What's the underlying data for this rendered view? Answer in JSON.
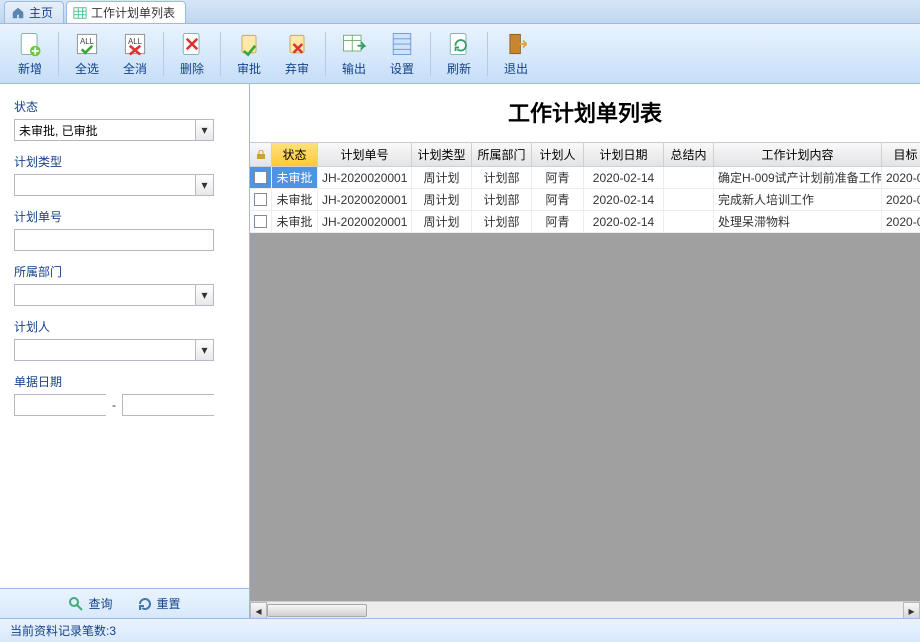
{
  "tabs": [
    {
      "label": "主页",
      "icon": "home"
    },
    {
      "label": "工作计划单列表",
      "icon": "grid",
      "active": true
    }
  ],
  "toolbar": [
    {
      "key": "new",
      "label": "新增"
    },
    {
      "key": "selall",
      "label": "全选"
    },
    {
      "key": "desel",
      "label": "全消"
    },
    {
      "key": "delete",
      "label": "删除"
    },
    {
      "key": "approve",
      "label": "审批"
    },
    {
      "key": "reject",
      "label": "弃审"
    },
    {
      "key": "export",
      "label": "输出"
    },
    {
      "key": "settings",
      "label": "设置"
    },
    {
      "key": "refresh",
      "label": "刷新"
    },
    {
      "key": "exit",
      "label": "退出"
    }
  ],
  "title": "工作计划单列表",
  "filters": {
    "status": {
      "label": "状态",
      "value": "未审批, 已审批"
    },
    "plantype": {
      "label": "计划类型",
      "value": ""
    },
    "planno": {
      "label": "计划单号",
      "value": ""
    },
    "dept": {
      "label": "所属部门",
      "value": ""
    },
    "planner": {
      "label": "计划人",
      "value": ""
    },
    "date": {
      "label": "单据日期",
      "from": "",
      "to": "",
      "sep": "-"
    }
  },
  "sidefoot": {
    "query": "查询",
    "reset": "重置"
  },
  "grid": {
    "headers": [
      "",
      "状态",
      "计划单号",
      "计划类型",
      "所属部门",
      "计划人",
      "计划日期",
      "总结内",
      "工作计划内容",
      "目标"
    ],
    "sorted_col": 1,
    "rows": [
      {
        "selected": true,
        "status": "未审批",
        "no": "JH-2020020001",
        "type": "周计划",
        "dept": "计划部",
        "planner": "阿青",
        "date": "2020-02-14",
        "summary": "",
        "content": "确定H-009试产计划前准备工作",
        "target": "2020-0"
      },
      {
        "selected": false,
        "status": "未审批",
        "no": "JH-2020020001",
        "type": "周计划",
        "dept": "计划部",
        "planner": "阿青",
        "date": "2020-02-14",
        "summary": "",
        "content": "完成新人培训工作",
        "target": "2020-0"
      },
      {
        "selected": false,
        "status": "未审批",
        "no": "JH-2020020001",
        "type": "周计划",
        "dept": "计划部",
        "planner": "阿青",
        "date": "2020-02-14",
        "summary": "",
        "content": "处理呆滞物料",
        "target": "2020-0"
      }
    ]
  },
  "statusbar": {
    "text": "当前资料记录笔数:3"
  }
}
